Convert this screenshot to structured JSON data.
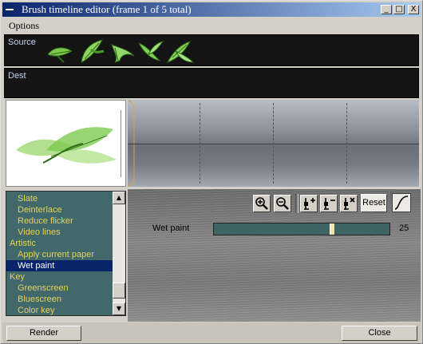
{
  "window": {
    "title": "Brush timeline editor  (frame 1 of  5 total)",
    "controls": {
      "minimize": "_",
      "maximize": "□",
      "close": "X"
    }
  },
  "menu": {
    "options": "Options"
  },
  "source": {
    "label": "Source"
  },
  "dest": {
    "label": "Dest"
  },
  "list": {
    "items": [
      {
        "label": "Slate",
        "indent": true,
        "selected": false
      },
      {
        "label": "Deinterlace",
        "indent": true,
        "selected": false
      },
      {
        "label": "Reduce flicker",
        "indent": true,
        "selected": false
      },
      {
        "label": "Video lines",
        "indent": true,
        "selected": false
      },
      {
        "label": "Artistic",
        "indent": false,
        "selected": false
      },
      {
        "label": "Apply current paper",
        "indent": true,
        "selected": false
      },
      {
        "label": "Wet paint",
        "indent": true,
        "selected": true
      },
      {
        "label": "Key",
        "indent": false,
        "selected": false
      },
      {
        "label": "Greenscreen",
        "indent": true,
        "selected": false
      },
      {
        "label": "Bluescreen",
        "indent": true,
        "selected": false
      },
      {
        "label": "Color key",
        "indent": true,
        "selected": false
      }
    ]
  },
  "toolbar": {
    "reset_label": "Reset"
  },
  "parameter": {
    "name": "Wet paint",
    "value": "25",
    "slider_fraction": 0.68
  },
  "buttons": {
    "render": "Render",
    "close": "Close"
  },
  "colors": {
    "title_start": "#0a246a",
    "title_end": "#a6caf0",
    "list_bg": "#41686a",
    "list_text": "#e6d15c",
    "selection": "#0a246a"
  }
}
